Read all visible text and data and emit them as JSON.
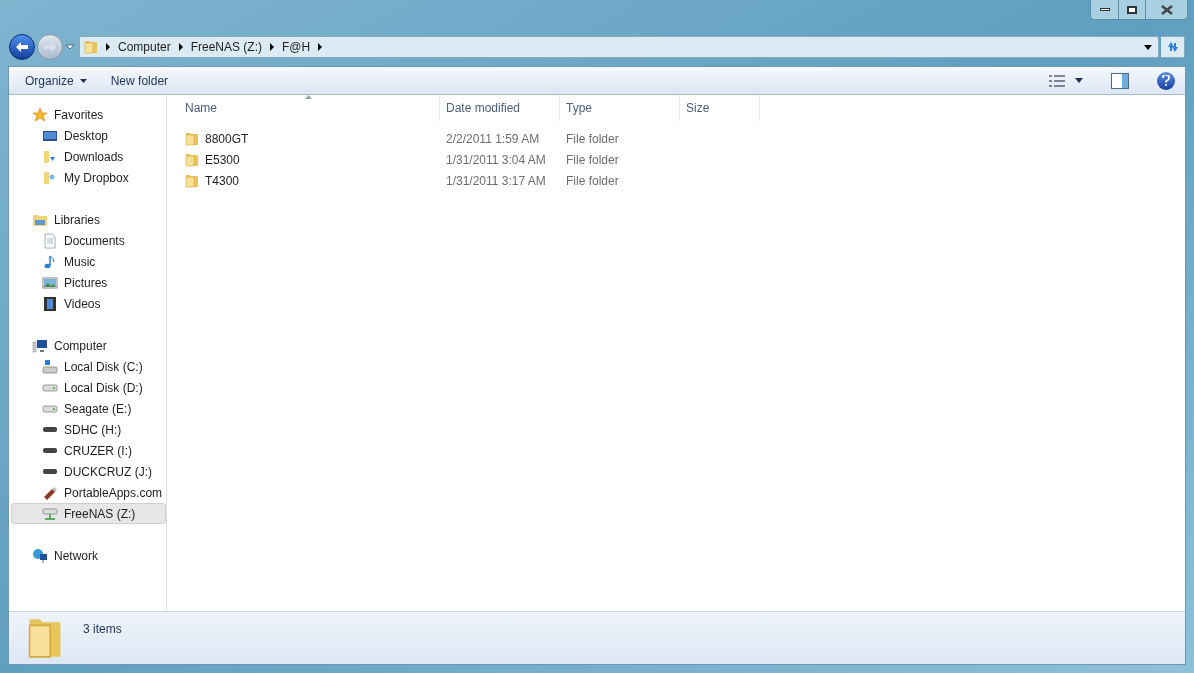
{
  "breadcrumb": [
    "Computer",
    "FreeNAS (Z:)",
    "F@H"
  ],
  "toolbar": {
    "organize": "Organize",
    "new_folder": "New folder"
  },
  "sidebar": [
    {
      "label": "Favorites",
      "kind": "star",
      "selected": false,
      "children": [
        {
          "label": "Desktop",
          "kind": "desktop",
          "selected": false
        },
        {
          "label": "Downloads",
          "kind": "downloads",
          "selected": false
        },
        {
          "label": "My Dropbox",
          "kind": "folder",
          "selected": false
        }
      ]
    },
    {
      "label": "Libraries",
      "kind": "library",
      "selected": false,
      "children": [
        {
          "label": "Documents",
          "kind": "document",
          "selected": false
        },
        {
          "label": "Music",
          "kind": "music",
          "selected": false
        },
        {
          "label": "Pictures",
          "kind": "picture",
          "selected": false
        },
        {
          "label": "Videos",
          "kind": "video",
          "selected": false
        }
      ]
    },
    {
      "label": "Computer",
      "kind": "computer",
      "selected": false,
      "children": [
        {
          "label": "Local Disk (C:)",
          "kind": "system-disk",
          "selected": false
        },
        {
          "label": "Local Disk (D:)",
          "kind": "disk",
          "selected": false
        },
        {
          "label": "Seagate (E:)",
          "kind": "disk",
          "selected": false
        },
        {
          "label": "SDHC (H:)",
          "kind": "removable",
          "selected": false
        },
        {
          "label": "CRUZER (I:)",
          "kind": "removable",
          "selected": false
        },
        {
          "label": "DUCKCRUZ (J:)",
          "kind": "removable",
          "selected": false
        },
        {
          "label": "PortableApps.com",
          "kind": "usb",
          "selected": false
        },
        {
          "label": "FreeNAS (Z:)",
          "kind": "network-drive",
          "selected": true
        }
      ]
    },
    {
      "label": "Network",
      "kind": "network",
      "selected": false
    }
  ],
  "columns": [
    "Name",
    "Date modified",
    "Type",
    "Size"
  ],
  "rows": [
    {
      "name": "8800GT",
      "date": "2/2/2011 1:59 AM",
      "type": "File folder"
    },
    {
      "name": "E5300",
      "date": "1/31/2011 3:04 AM",
      "type": "File folder"
    },
    {
      "name": "T4300",
      "date": "1/31/2011 3:17 AM",
      "type": "File folder"
    }
  ],
  "status": "3 items"
}
